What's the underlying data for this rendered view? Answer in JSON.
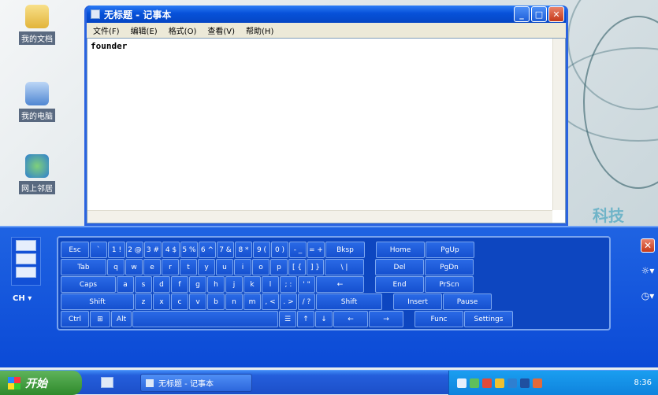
{
  "desktop": {
    "icons": [
      {
        "label": "我的文档",
        "icon": "folder-icon"
      },
      {
        "label": "我的电脑",
        "icon": "computer-icon"
      },
      {
        "label": "网上邻居",
        "icon": "network-icon"
      }
    ],
    "brand_text": "科技"
  },
  "notepad": {
    "title": "无标题 - 记事本",
    "menu": [
      "文件(F)",
      "编辑(E)",
      "格式(O)",
      "查看(V)",
      "帮助(H)"
    ],
    "content": "founder",
    "buttons": {
      "minimize": "_",
      "maximize": "□",
      "close": "✕"
    }
  },
  "keyboard": {
    "lang": "CH ▾",
    "rows": [
      [
        "Esc",
        "`",
        "1 !",
        "2 @",
        "3 #",
        "4 $",
        "5 %",
        "6 ^",
        "7 &",
        "8 *",
        "9 (",
        "0 )",
        "- _",
        "= +",
        "Bksp",
        "Home",
        "PgUp"
      ],
      [
        "Tab",
        "q",
        "w",
        "e",
        "r",
        "t",
        "y",
        "u",
        "i",
        "o",
        "p",
        "[ {",
        "] }",
        "\\ |",
        "Del",
        "PgDn"
      ],
      [
        "Caps",
        "a",
        "s",
        "d",
        "f",
        "g",
        "h",
        "j",
        "k",
        "l",
        "; :",
        "' \"",
        "←",
        "End",
        "PrScn"
      ],
      [
        "Shift",
        "z",
        "x",
        "c",
        "v",
        "b",
        "n",
        "m",
        ", <",
        ". >",
        "/ ?",
        "Shift",
        "Insert",
        "Pause"
      ],
      [
        "Ctrl",
        "⊞",
        "Alt",
        "",
        "☰",
        "↑",
        "↓",
        "←",
        "→",
        "Func",
        "Settings"
      ]
    ],
    "right_buttons": [
      "✕",
      "☼▾",
      "◷▾"
    ]
  },
  "taskbar": {
    "start_label": "开始",
    "task_label": "无标题 - 记事本",
    "clock": "8:36"
  }
}
